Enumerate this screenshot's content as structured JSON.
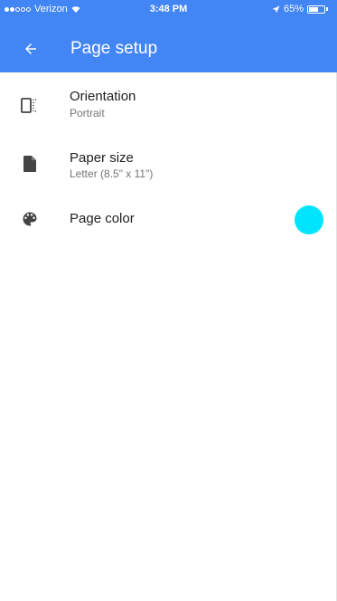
{
  "status_bar": {
    "carrier": "Verizon",
    "time": "3:48 PM",
    "battery": "65%",
    "battery_level": 0.65
  },
  "app_bar": {
    "title": "Page setup",
    "back_icon": "arrow-back-icon",
    "color": "#4285f4"
  },
  "settings": {
    "orientation": {
      "icon": "orientation-icon",
      "title": "Orientation",
      "value": "Portrait"
    },
    "paper_size": {
      "icon": "document-icon",
      "title": "Paper size",
      "value": "Letter (8.5\" x 11\")"
    },
    "page_color": {
      "icon": "palette-icon",
      "title": "Page color",
      "swatch_color": "#00e5ff"
    }
  }
}
